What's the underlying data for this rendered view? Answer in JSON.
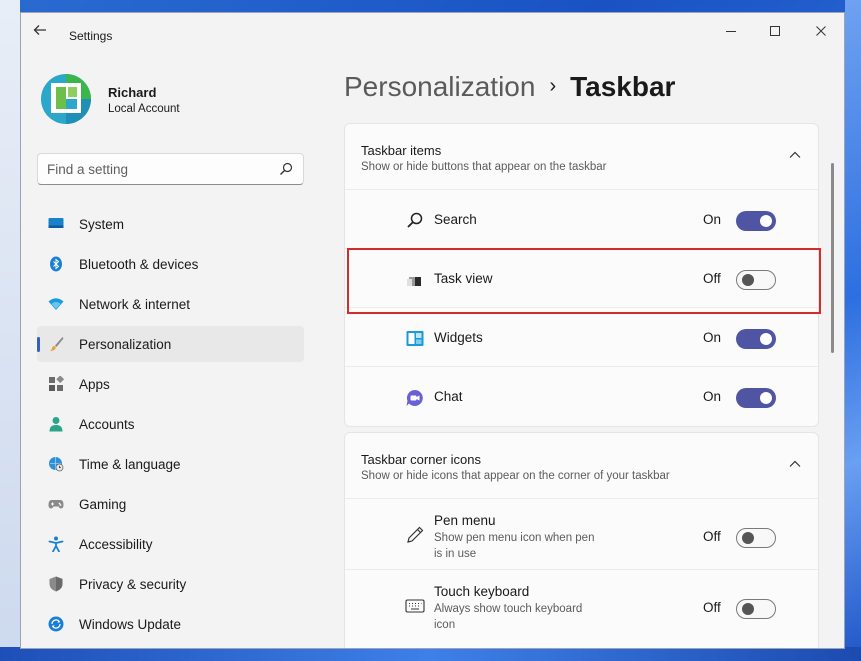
{
  "window": {
    "title": "Settings"
  },
  "user": {
    "name": "Richard",
    "account_type": "Local Account"
  },
  "search": {
    "placeholder": "Find a setting"
  },
  "nav": {
    "items": [
      {
        "label": "System",
        "icon": "system-icon"
      },
      {
        "label": "Bluetooth & devices",
        "icon": "bluetooth-icon"
      },
      {
        "label": "Network & internet",
        "icon": "wifi-icon"
      },
      {
        "label": "Personalization",
        "icon": "brush-icon",
        "selected": true
      },
      {
        "label": "Apps",
        "icon": "apps-icon"
      },
      {
        "label": "Accounts",
        "icon": "person-icon"
      },
      {
        "label": "Time & language",
        "icon": "globe-clock-icon"
      },
      {
        "label": "Gaming",
        "icon": "gamepad-icon"
      },
      {
        "label": "Accessibility",
        "icon": "accessibility-icon"
      },
      {
        "label": "Privacy & security",
        "icon": "shield-icon"
      },
      {
        "label": "Windows Update",
        "icon": "update-icon"
      }
    ]
  },
  "breadcrumb": {
    "parent": "Personalization",
    "separator": "›",
    "current": "Taskbar"
  },
  "taskbar_items": {
    "title": "Taskbar items",
    "subtitle": "Show or hide buttons that appear on the taskbar",
    "rows": [
      {
        "label": "Search",
        "state": "On",
        "icon": "search-icon"
      },
      {
        "label": "Task view",
        "state": "Off",
        "icon": "task-view-icon"
      },
      {
        "label": "Widgets",
        "state": "On",
        "icon": "widgets-icon"
      },
      {
        "label": "Chat",
        "state": "On",
        "icon": "chat-icon"
      }
    ]
  },
  "corner_icons": {
    "title": "Taskbar corner icons",
    "subtitle": "Show or hide icons that appear on the corner of your taskbar",
    "rows": [
      {
        "label": "Pen menu",
        "description": "Show pen menu icon when pen is in use",
        "state": "Off",
        "icon": "pen-icon"
      },
      {
        "label": "Touch keyboard",
        "description": "Always show touch keyboard icon",
        "state": "Off",
        "icon": "keyboard-icon"
      }
    ]
  },
  "colors": {
    "accent": "#4f55a3",
    "highlight": "#d62b2b",
    "selection_bar": "#3460c0"
  }
}
